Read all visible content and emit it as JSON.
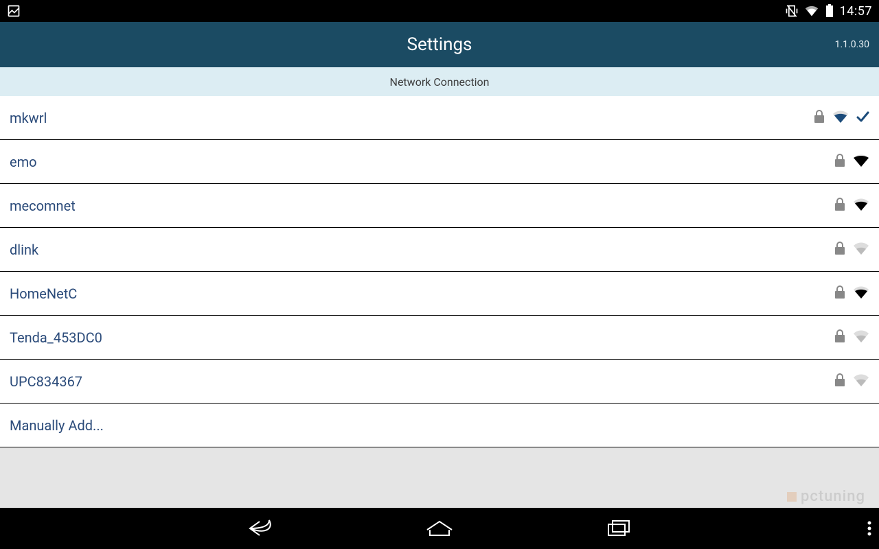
{
  "status": {
    "clock": "14:57"
  },
  "header": {
    "title": "Settings",
    "version": "1.1.0.30"
  },
  "subheader": {
    "label": "Network Connection"
  },
  "networks": [
    {
      "ssid": "mkwrl",
      "locked": true,
      "signal": 3,
      "signal_color": "blue",
      "connected": true
    },
    {
      "ssid": "emo",
      "locked": true,
      "signal": 4,
      "signal_color": "black",
      "connected": false
    },
    {
      "ssid": "mecomnet",
      "locked": true,
      "signal": 3,
      "signal_color": "black",
      "connected": false
    },
    {
      "ssid": "dlink",
      "locked": true,
      "signal": 2,
      "signal_color": "gray",
      "connected": false
    },
    {
      "ssid": "HomeNetC",
      "locked": true,
      "signal": 3,
      "signal_color": "black",
      "connected": false
    },
    {
      "ssid": "Tenda_453DC0",
      "locked": true,
      "signal": 2,
      "signal_color": "gray",
      "connected": false
    },
    {
      "ssid": "UPC834367",
      "locked": true,
      "signal": 2,
      "signal_color": "gray",
      "connected": false
    }
  ],
  "manual": {
    "label": "Manually Add..."
  },
  "watermark": {
    "text": "pctuning"
  }
}
